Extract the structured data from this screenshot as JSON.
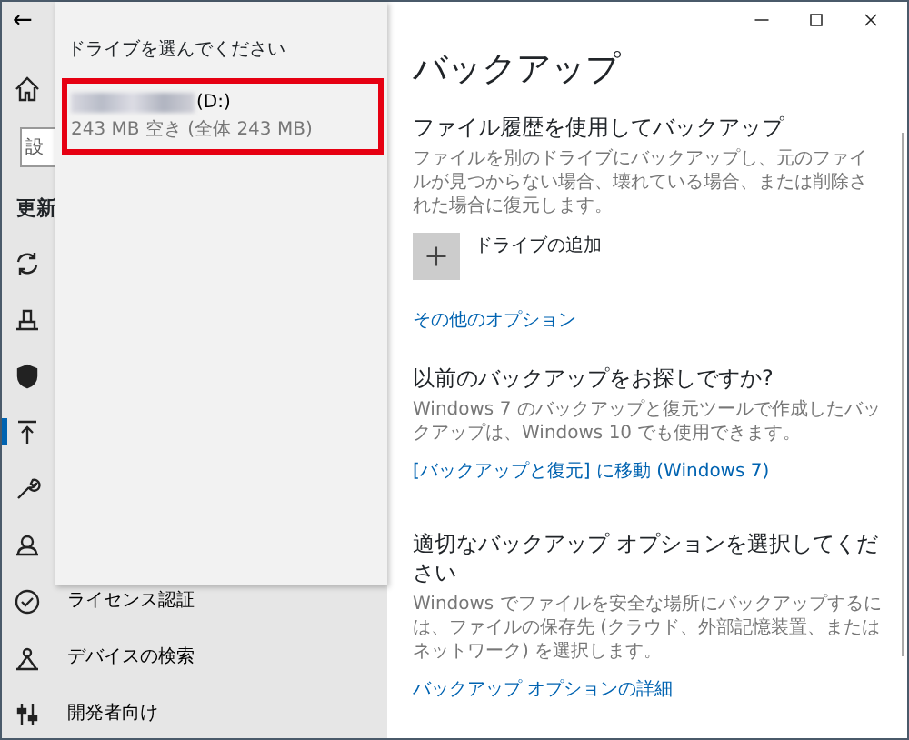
{
  "nav": {
    "back_button": "←",
    "search_partial": "設",
    "section_partial": "更新",
    "items": [
      {
        "selected": false
      },
      {
        "selected": false
      },
      {
        "selected": false
      },
      {
        "selected": false
      },
      {
        "selected": true
      },
      {
        "selected": false
      },
      {
        "selected": false
      },
      {
        "label": "ライセンス認証",
        "selected": false
      },
      {
        "label": "デバイスの検索",
        "selected": false
      },
      {
        "label": "開発者向け",
        "selected": false
      }
    ]
  },
  "flyout": {
    "heading": "ドライブを選んでください",
    "drives": [
      {
        "letter": "(D:)",
        "space": "243 MB 空き (全体 243 MB)",
        "highlighted": true
      }
    ]
  },
  "page": {
    "title": "バックアップ",
    "sections": [
      {
        "heading": "ファイル履歴を使用してバックアップ",
        "text": "ファイルを別のドライブにバックアップし、元のファイルが見つからない場合、壊れている場合、または削除された場合に復元します。",
        "add_drive": "ドライブの追加",
        "link": "その他のオプション"
      },
      {
        "heading": "以前のバックアップをお探しですか?",
        "text": "Windows 7 のバックアップと復元ツールで作成したバックアップは、Windows 10 でも使用できます。",
        "link": "[バックアップと復元] に移動 (Windows 7)"
      },
      {
        "heading": "適切なバックアップ オプションを選択してください",
        "text": "Windows でファイルを安全な場所にバックアップするには、ファイルの保存先 (クラウド、外部記憶装置、またはネットワーク) を選択します。",
        "link": "バックアップ オプションの詳細"
      }
    ]
  }
}
